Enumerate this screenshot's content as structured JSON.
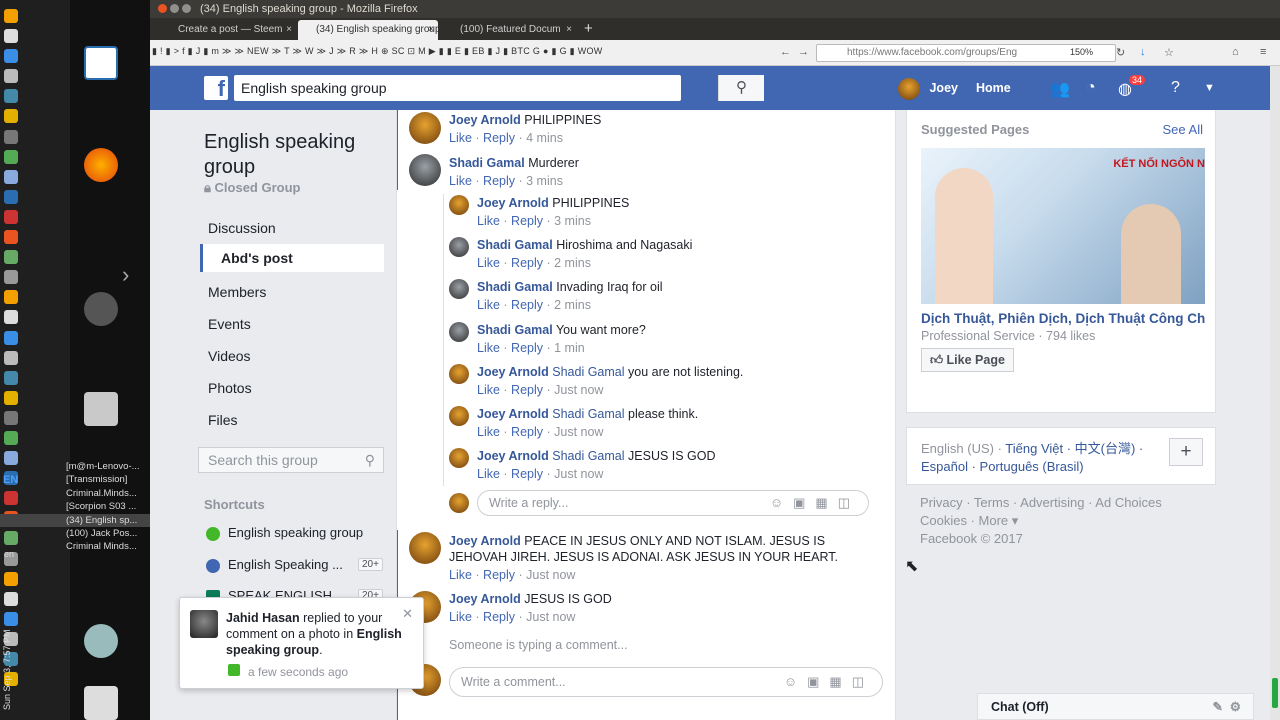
{
  "window": {
    "title": "(34) English speaking group - Mozilla Firefox"
  },
  "tabs": [
    {
      "label": "Create a post — Steem"
    },
    {
      "label": "(34) English speaking group"
    },
    {
      "label": "(100) Featured Docum"
    }
  ],
  "bookmarks_text": "▮ ! ▮ > f ▮ J ▮ m ≫ ≫ NEW ≫ T ≫ W ≫ J ≫ R ≫ H ⊕ SC ⊡ M ▶ ▮ ▮ E ▮ EB ▮ J ▮ BTC G ● ▮ G ▮ WOW",
  "url": "https://www.facebook.com/groups/Eng",
  "zoom": "150%",
  "taskbar": {
    "items": [
      "[m@m-Lenovo-...",
      "[Transmission]",
      "Criminal.Minds...",
      "[Scorpion S03 ...",
      "(34) English sp...",
      "(100) Jack Pos...",
      "Criminal Minds..."
    ],
    "lang": "EN",
    "lang2": "en",
    "clock": "Sun Sep 3, 7:57 PM"
  },
  "fb": {
    "logo": "f",
    "search_value": "English speaking group",
    "user": "Joey",
    "home": "Home",
    "notif_count": "34"
  },
  "group": {
    "name": "English speaking group",
    "type": "Closed Group",
    "nav": [
      "Discussion",
      "Abd's post",
      "Members",
      "Events",
      "Videos",
      "Photos",
      "Files"
    ],
    "search_placeholder": "Search this group",
    "shortcuts_title": "Shortcuts",
    "shortcuts": [
      {
        "label": "English speaking group",
        "count": ""
      },
      {
        "label": "English Speaking ...",
        "count": "20+"
      },
      {
        "label": "SPEAK ENGLISH",
        "count": "20+"
      }
    ]
  },
  "comments": [
    {
      "author": "Joey Arnold",
      "mention": "",
      "text": "PHILIPPINES",
      "like": "Like",
      "reply": "Reply",
      "time": "4 mins"
    },
    {
      "author": "Shadi Gamal",
      "mention": "",
      "text": "Murderer",
      "like": "Like",
      "reply": "Reply",
      "time": "3 mins"
    },
    {
      "author": "Joey Arnold",
      "mention": "",
      "text": "PHILIPPINES",
      "like": "Like",
      "reply": "Reply",
      "time": "3 mins"
    },
    {
      "author": "Shadi Gamal",
      "mention": "",
      "text": "Hiroshima and Nagasaki",
      "like": "Like",
      "reply": "Reply",
      "time": "2 mins"
    },
    {
      "author": "Shadi Gamal",
      "mention": "",
      "text": "Invading Iraq for oil",
      "like": "Like",
      "reply": "Reply",
      "time": "2 mins"
    },
    {
      "author": "Shadi Gamal",
      "mention": "",
      "text": "You want more?",
      "like": "Like",
      "reply": "Reply",
      "time": "1 min"
    },
    {
      "author": "Joey Arnold",
      "mention": "Shadi Gamal",
      "text": "you are not listening.",
      "like": "Like",
      "reply": "Reply",
      "time": "Just now"
    },
    {
      "author": "Joey Arnold",
      "mention": "Shadi Gamal",
      "text": "please think.",
      "like": "Like",
      "reply": "Reply",
      "time": "Just now"
    },
    {
      "author": "Joey Arnold",
      "mention": "Shadi Gamal",
      "text": "JESUS IS GOD",
      "like": "Like",
      "reply": "Reply",
      "time": "Just now"
    },
    {
      "author": "Joey Arnold",
      "mention": "",
      "text": "PEACE IN JESUS ONLY AND NOT ISLAM. JESUS IS JEHOVAH JIREH. JESUS IS ADONAI. ASK JESUS IN YOUR HEART.",
      "like": "Like",
      "reply": "Reply",
      "time": "Just now"
    },
    {
      "author": "Joey Arnold",
      "mention": "",
      "text": "JESUS IS GOD",
      "like": "Like",
      "reply": "Reply",
      "time": "Just now"
    }
  ],
  "reply_placeholder": "Write a reply...",
  "typing_text": "Someone is typing a comment...",
  "comment_placeholder": "Write a comment...",
  "suggested": {
    "title": "Suggested Pages",
    "see_all": "See All",
    "image_text": "KẾT NỐI NGÔN N",
    "page_name": "Dịch Thuật, Phiên Dịch, Dịch Thuật Công Chứng",
    "meta": "Professional Service · 794 likes",
    "like_button": "Like Page"
  },
  "languages": {
    "current": "English (US)",
    "line1_links": "Tiếng Việt · 中文(台灣) ·",
    "line2": "Español · Português (Brasil)",
    "plus": "+"
  },
  "footer": {
    "line1": "Privacy · Terms · Advertising · Ad Choices",
    "line2": "Cookies · More ▾",
    "line3": "Facebook © 2017"
  },
  "chat": {
    "label": "Chat (Off)"
  },
  "toast": {
    "name": "Jahid Hasan",
    "text1": " replied to your comment on a photo in ",
    "group": "English speaking group",
    "tail": ".",
    "time": "a few seconds ago"
  }
}
